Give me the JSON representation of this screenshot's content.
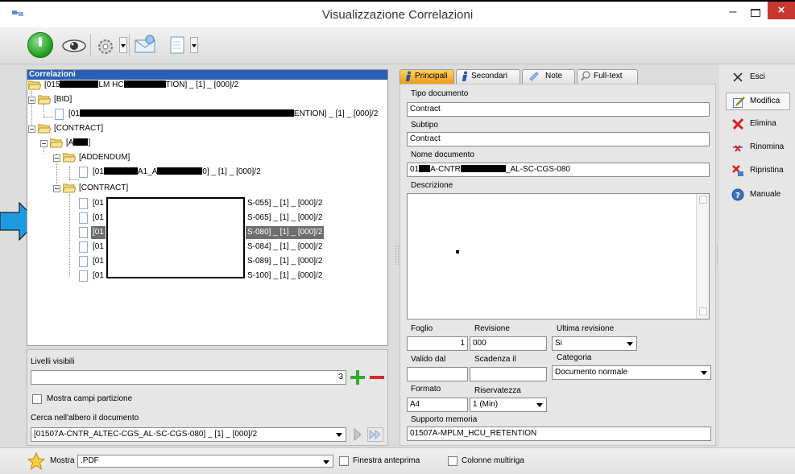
{
  "window": {
    "title": "Visualizzazione Correlazioni",
    "close_label": "×"
  },
  "tree": {
    "header": "Correlazioni",
    "nodes": [
      {
        "label_pre": "[015",
        "label_mid": "LM HC",
        "label_post": "TION] _ [1] _ [000]/2"
      },
      {
        "label": "[BID]"
      },
      {
        "label_pre": "[01",
        "label_post": "ENTION] _ [1] _ [000]/2"
      },
      {
        "label": "[CONTRACT]"
      },
      {
        "label_pre": "[A",
        "label_post": "]"
      },
      {
        "label": "[ADDENDUM]"
      },
      {
        "label_pre": "[01",
        "label_mid": "A1_A",
        "label_post": "0] _ [1] _ [000]/2"
      },
      {
        "label": "[CONTRACT]"
      }
    ],
    "contract_docs": [
      {
        "prefix": "[01",
        "suffix": "S-055] _ [1] _ [000]/2"
      },
      {
        "prefix": "[01",
        "suffix": "S-065] _ [1] _ [000]/2"
      },
      {
        "prefix": "[01",
        "suffix": "S-080] _ [1] _ [000]/2"
      },
      {
        "prefix": "[01",
        "suffix": "S-084] _ [1] _ [000]/2"
      },
      {
        "prefix": "[01",
        "suffix": "S-089] _ [1] _ [000]/2"
      },
      {
        "prefix": "[01",
        "suffix": "S-100] _ [1] _ [000]/2"
      }
    ]
  },
  "bottom_left": {
    "livelli_label": "Livelli visibili",
    "livelli_value": "3",
    "mostra_partizione_label": "Mostra campi partizione",
    "cerca_label": "Cerca nell'albero il documento",
    "cerca_value": "[01507A-CNTR_ALTEC-CGS_AL-SC-CGS-080] _ [1] _ [000]/2"
  },
  "tabs": [
    {
      "label": "Principali"
    },
    {
      "label": "Secondari"
    },
    {
      "label": "Note"
    },
    {
      "label": "Full-text"
    }
  ],
  "detail": {
    "tipo_label": "Tipo documento",
    "tipo_value": "Contract",
    "subtipo_label": "Subtipo",
    "subtipo_value": "Contract",
    "nome_label": "Nome documento",
    "nome_pre": "01",
    "nome_mid": "A-CNTR",
    "nome_post": "_AL-SC-CGS-080",
    "descrizione_label": "Descrizione",
    "foglio_label": "Foglio",
    "foglio_value": "1",
    "revisione_label": "Revisione",
    "revisione_value": "000",
    "ultima_label": "Ultima revisione",
    "ultima_value": "Si",
    "valido_label": "Valido dal",
    "valido_value": "",
    "scadenza_label": "Scadenza il",
    "scadenza_value": "",
    "categoria_label": "Categoria",
    "categoria_value": "Documento normale",
    "formato_label": "Formato",
    "formato_value": "A4",
    "riservatezza_label": "Riservatezza",
    "riservatezza_value": "1 (Min)",
    "supporto_label": "Supporto memoria",
    "supporto_value": "01507A-MPLM_HCU_RETENTION"
  },
  "actions": [
    {
      "label": "Esci"
    },
    {
      "label": "Modifica"
    },
    {
      "label": "Elimina"
    },
    {
      "label": "Rinomina"
    },
    {
      "label": "Ripristina"
    },
    {
      "label": "Manuale"
    }
  ],
  "status": {
    "mostra_label": "Mostra",
    "mostra_value": ".PDF",
    "anteprima_label": "Finestra anteprima",
    "multiriga_label": "Colonne multiriga"
  },
  "colors": {
    "accent_blue": "#2a5fb3",
    "tab_active": "#f09a1a",
    "close_red": "#c7382f",
    "arrow_blue": "#1e9be0"
  }
}
